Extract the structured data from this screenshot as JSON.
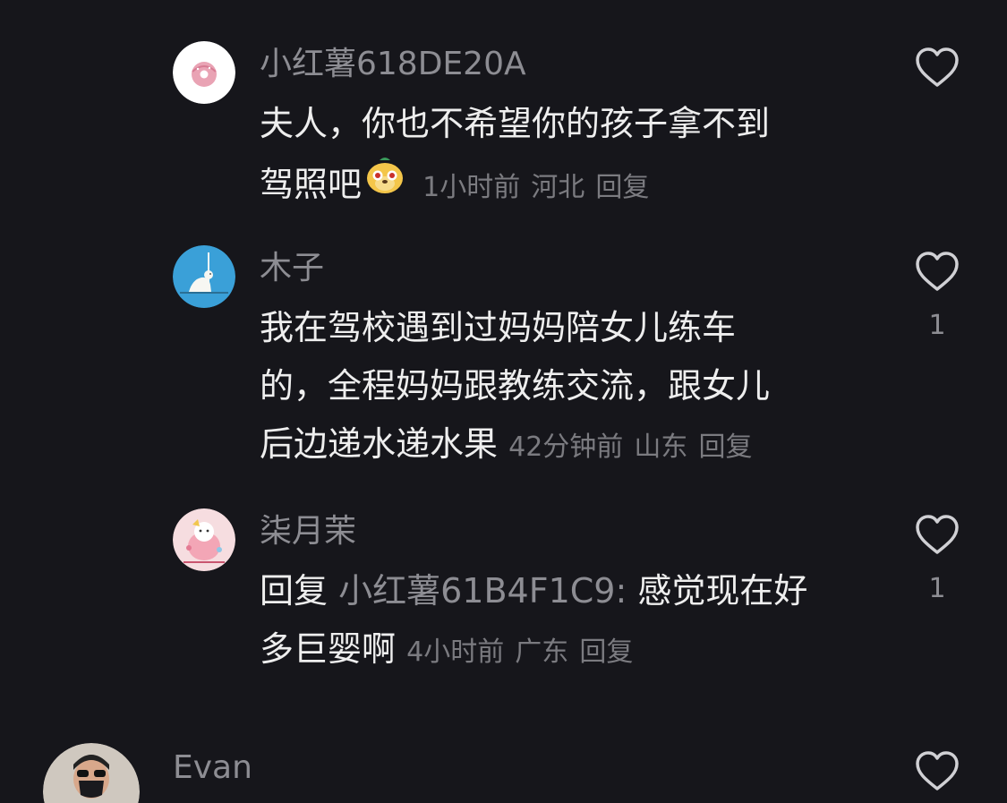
{
  "comments": [
    {
      "username": "小红薯618DE20A",
      "lines": [
        "夫人，你也不希望你的孩子拿不到",
        "驾照吧"
      ],
      "emoji": "yellow-dog-emoji",
      "time": "1小时前",
      "location": "河北",
      "reply_label": "回复",
      "likes": ""
    },
    {
      "username": "木子",
      "lines": [
        "我在驾校遇到过妈妈陪女儿练车",
        "的，全程妈妈跟教练交流，跟女儿",
        "后边递水递水果"
      ],
      "time": "42分钟前",
      "location": "山东",
      "reply_label": "回复",
      "likes": "1"
    },
    {
      "username": "柒月茉",
      "reply_prefix": "回复",
      "reply_target": "小红薯61B4F1C9:",
      "lines": [
        "感觉现在好",
        "多巨婴啊"
      ],
      "time": "4小时前",
      "location": "广东",
      "reply_label": "回复",
      "likes": "1"
    },
    {
      "username": "Evan",
      "likes": ""
    }
  ],
  "colors": {
    "background": "#16161b",
    "text": "#eeeeee",
    "muted": "#8d8d93",
    "meta": "#7b7b80"
  }
}
